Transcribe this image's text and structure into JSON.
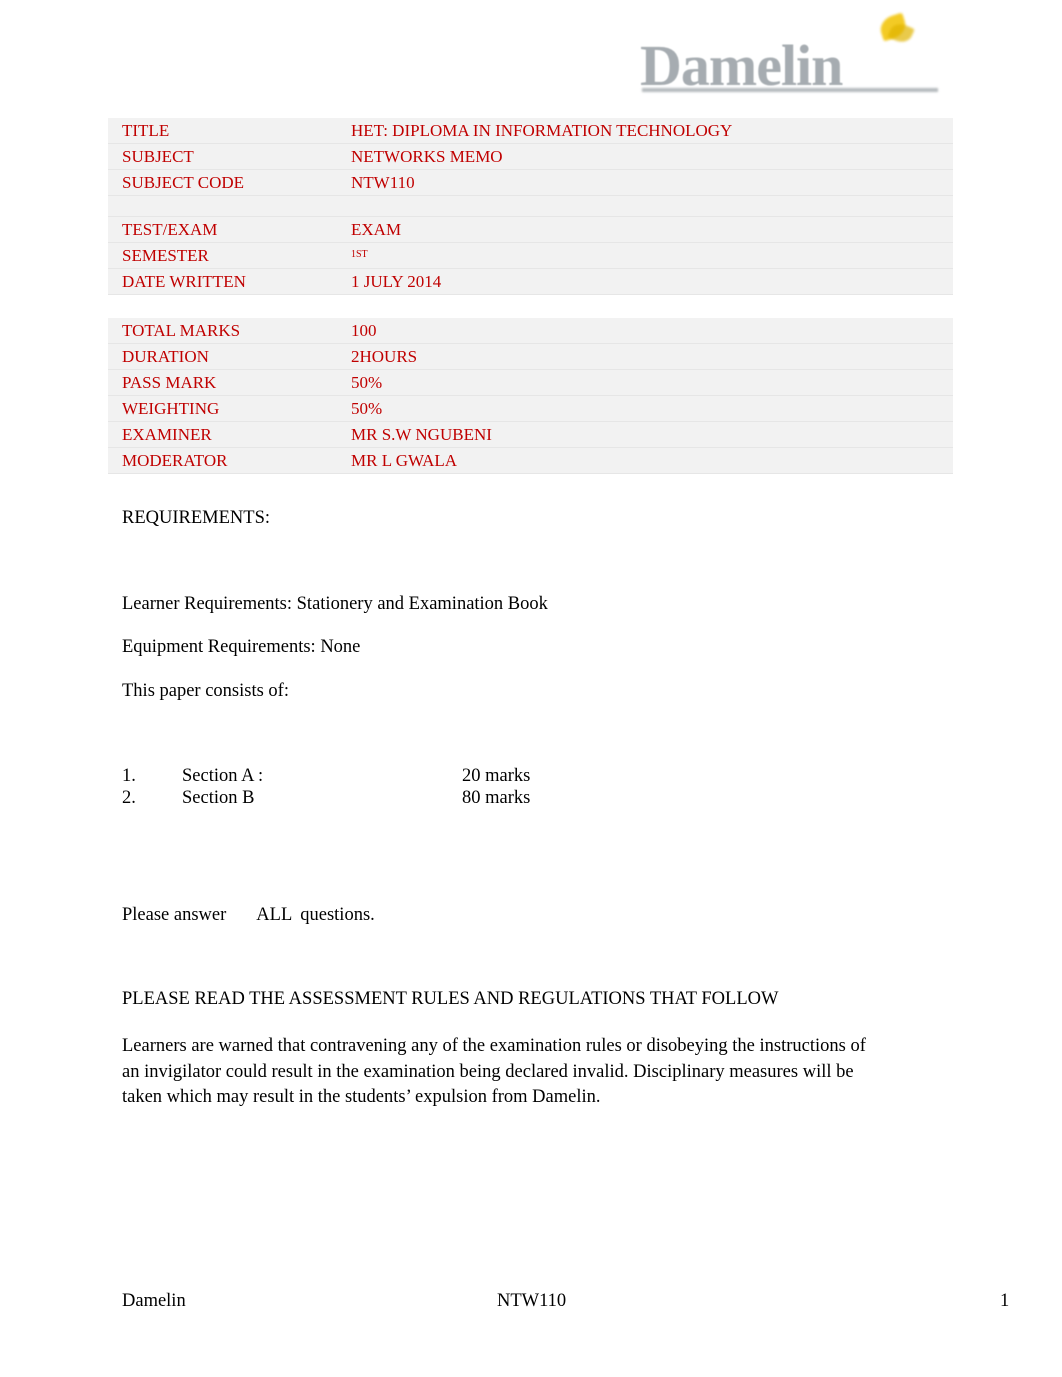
{
  "logo": {
    "brand": "Damelin",
    "leaf_icon": "leaf-icon"
  },
  "exam_info_top": [
    {
      "label": "TITLE",
      "value": "HET: DIPLOMA IN INFORMATION TECHNOLOGY"
    },
    {
      "label": "SUBJECT",
      "value": "NETWORKS MEMO"
    },
    {
      "label": "SUBJECT CODE",
      "value": "NTW110"
    },
    {
      "label": "",
      "value": ""
    },
    {
      "label": "TEST/EXAM",
      "value": "EXAM"
    },
    {
      "label": "SEMESTER",
      "value": "1ST",
      "superscript": true
    },
    {
      "label": "DATE WRITTEN",
      "value": "1 JULY 2014"
    }
  ],
  "exam_info_bottom": [
    {
      "label": "TOTAL MARKS",
      "value": "100"
    },
    {
      "label": "DURATION",
      "value": "2HOURS"
    },
    {
      "label": "PASS MARK",
      "value": "50%"
    },
    {
      "label": "WEIGHTING",
      "value": "50%"
    },
    {
      "label": "EXAMINER",
      "value": "MR S.W NGUBENI"
    },
    {
      "label": "MODERATOR",
      "value": "MR L GWALA"
    }
  ],
  "body": {
    "requirements_heading": "REQUIREMENTS:",
    "learner_requirements": "Learner Requirements: Stationery and Examination Book",
    "equipment_requirements": "Equipment Requirements: None",
    "paper_consists": "This paper consists of:",
    "sections": [
      {
        "num": "1.",
        "label": "Section A :",
        "marks": "20 marks"
      },
      {
        "num": "2.",
        "label": "Section B",
        "marks": "80 marks"
      }
    ],
    "answer_prefix": "Please answer",
    "answer_all": "ALL",
    "answer_suffix": "questions.",
    "rules_heading": "PLEASE READ THE ASSESSMENT RULES AND REGULATIONS THAT FOLLOW",
    "rules_paragraph": "Learners are warned that contravening any of the examination rules or disobeying the instructions of an invigilator could result in the examination being declared invalid. Disciplinary measures will be taken which may result in the students’ expulsion from Damelin."
  },
  "footer": {
    "left": "Damelin",
    "center": "NTW110",
    "right": "1"
  },
  "colors": {
    "table_text": "#c00000",
    "table_bg": "#f2f2f2",
    "logo_gray": "#5f6a72",
    "logo_gold": "#f2c200"
  }
}
